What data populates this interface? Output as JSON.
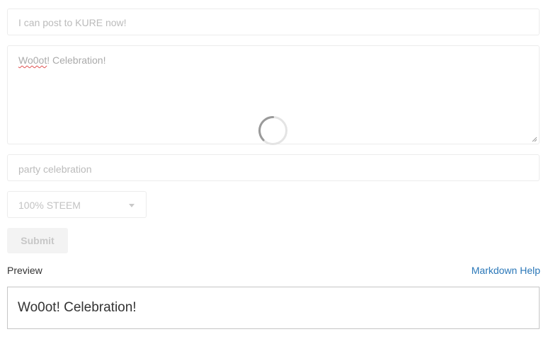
{
  "form": {
    "title_value": "I can post to KURE now!",
    "body_value_prefix": "Wo0ot",
    "body_value_rest": "! Celebration!",
    "tags_value": "party celebration",
    "reward_selected": "100% STEEM",
    "submit_label": "Submit"
  },
  "preview": {
    "label": "Preview",
    "markdown_help_label": "Markdown Help",
    "content": "Wo0ot! Celebration!"
  },
  "colors": {
    "link": "#2a77b8",
    "spelling_underline": "#e05050"
  }
}
